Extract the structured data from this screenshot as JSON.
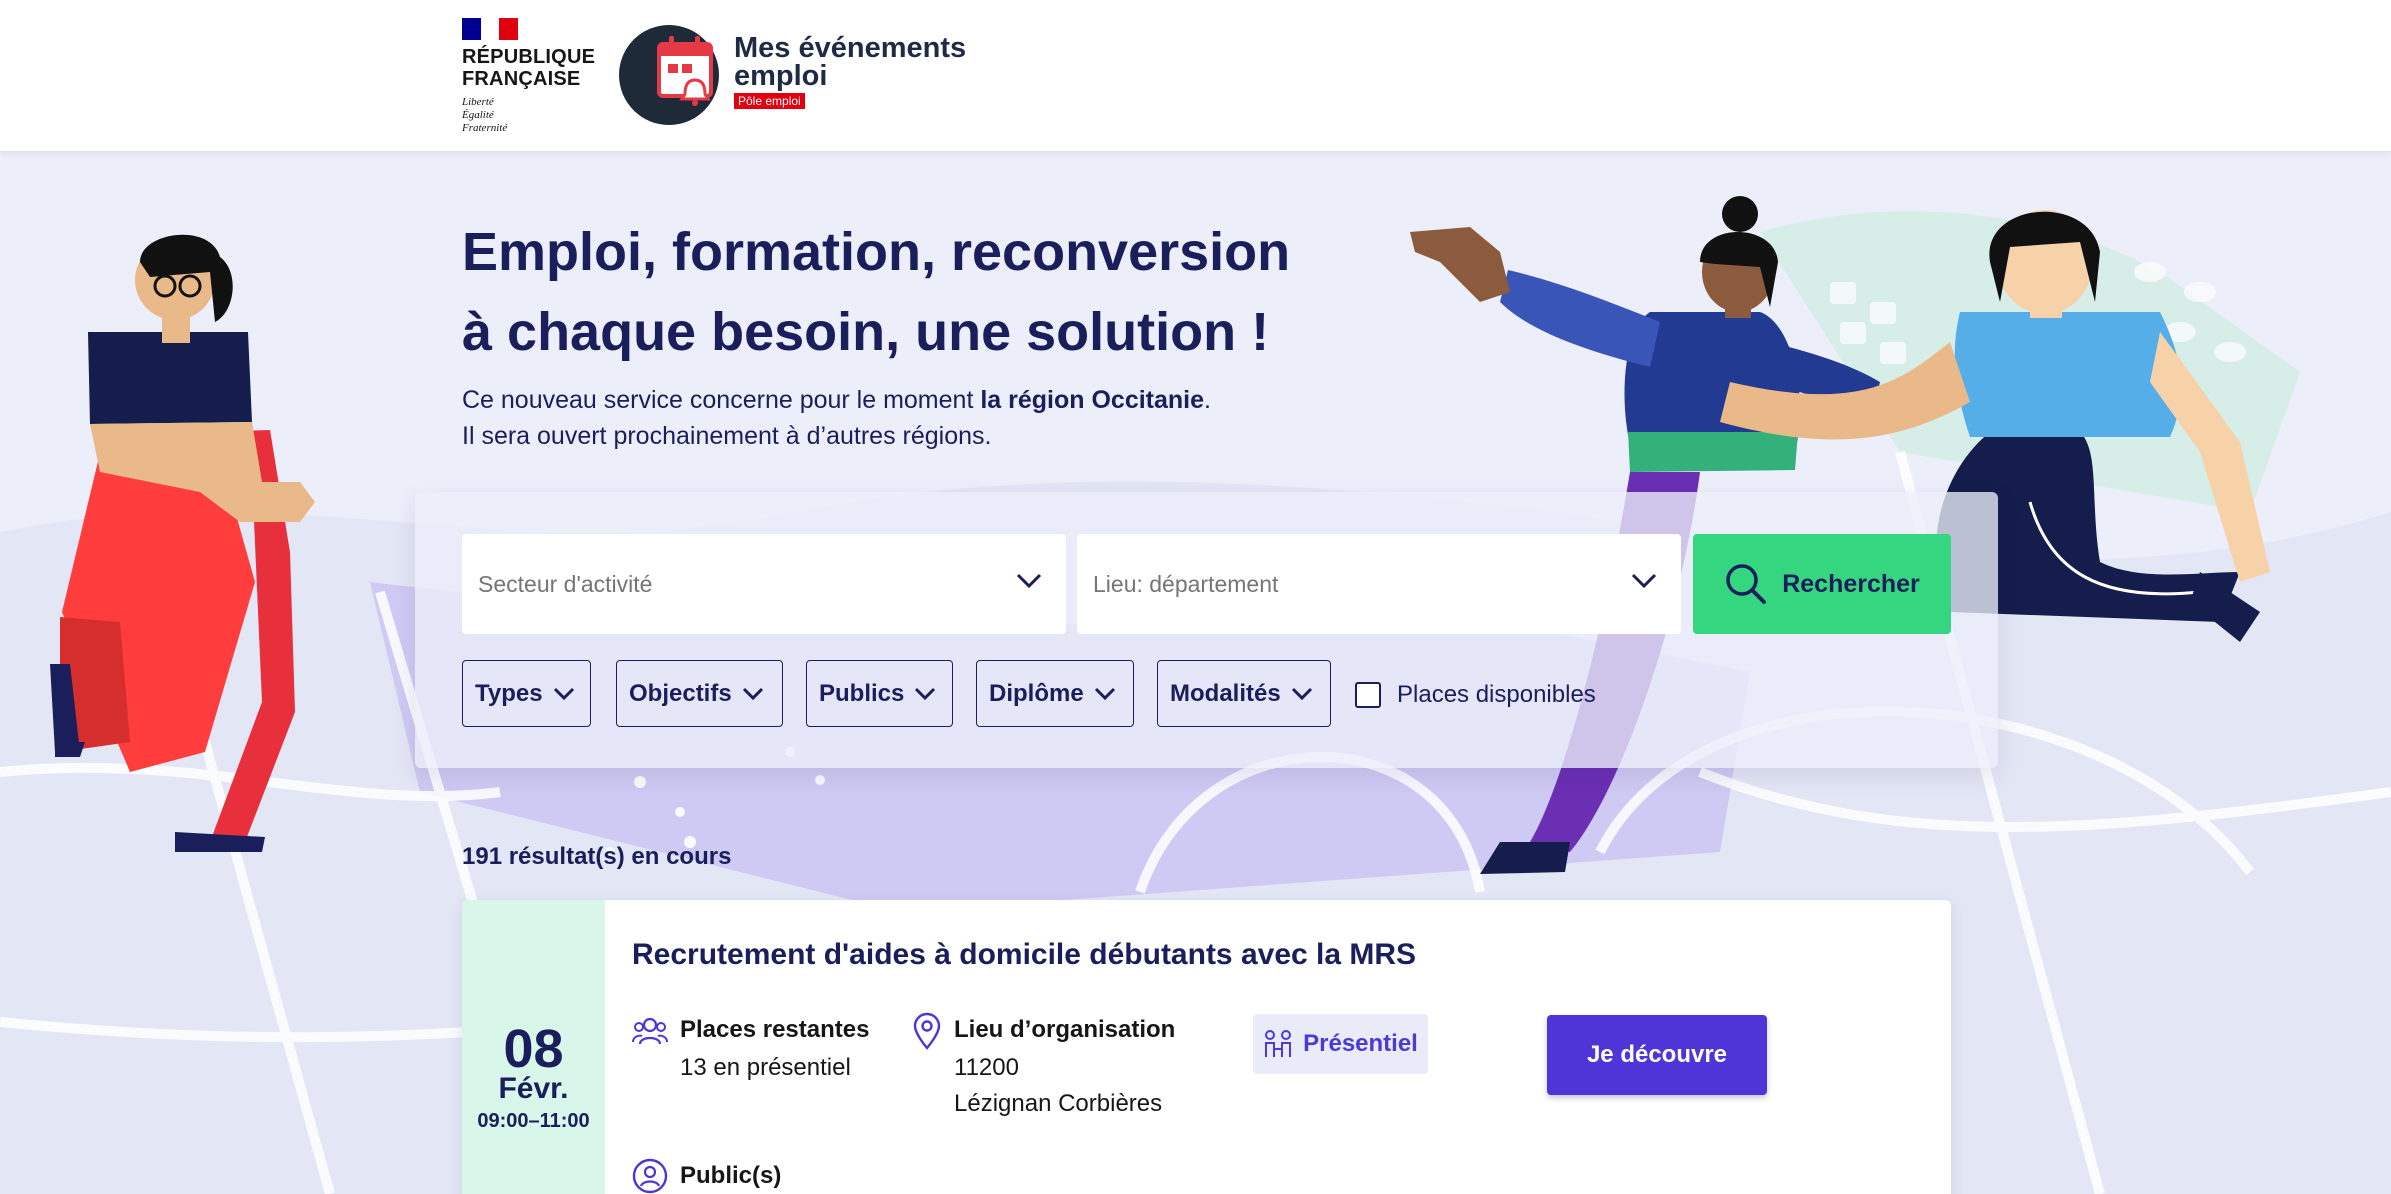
{
  "header": {
    "rf_title_line1": "RÉPUBLIQUE",
    "rf_title_line2": "FRANÇAISE",
    "rf_motto_line1": "Liberté",
    "rf_motto_line2": "Égalité",
    "rf_motto_line3": "Fraternité",
    "app_title_line1": "Mes événements",
    "app_title_line2": "emploi",
    "app_tag": "Pôle emploi"
  },
  "hero": {
    "title_line1": "Emploi, formation, reconversion",
    "title_line2": "à chaque besoin, une solution !",
    "sub_line1_prefix": "Ce nouveau service concerne pour le moment ",
    "sub_line1_bold": "la région Occitanie",
    "sub_line1_suffix": ".",
    "sub_line2": "Il sera ouvert prochainement à d’autres régions."
  },
  "search": {
    "sector_placeholder": "Secteur d'activité",
    "location_placeholder": "Lieu: département",
    "search_label": "Rechercher",
    "filters": [
      "Types",
      "Objectifs",
      "Publics",
      "Diplôme",
      "Modalités"
    ],
    "places_label": "Places disponibles",
    "places_checked": false
  },
  "results": {
    "count_label": "191 résultat(s) en cours"
  },
  "event": {
    "day": "08",
    "month": "Févr.",
    "time": "09:00–11:00",
    "title": "Recrutement d'aides à domicile débutants avec la MRS",
    "places_label": "Places restantes",
    "places_value": "13 en présentiel",
    "location_label": "Lieu d’organisation",
    "location_postcode": "11200",
    "location_city": "Lézignan Corbières",
    "mode": "Présentiel",
    "cta": "Je découvre",
    "public_label": "Public(s)"
  },
  "colors": {
    "navy": "#1a1f5c",
    "accent_green": "#34d680",
    "accent_violet": "#4f35d8",
    "date_bg": "#d9f6ea",
    "hero_bg": "#eceefa",
    "marianne_blue": "#000091",
    "marianne_red": "#e1000f"
  }
}
